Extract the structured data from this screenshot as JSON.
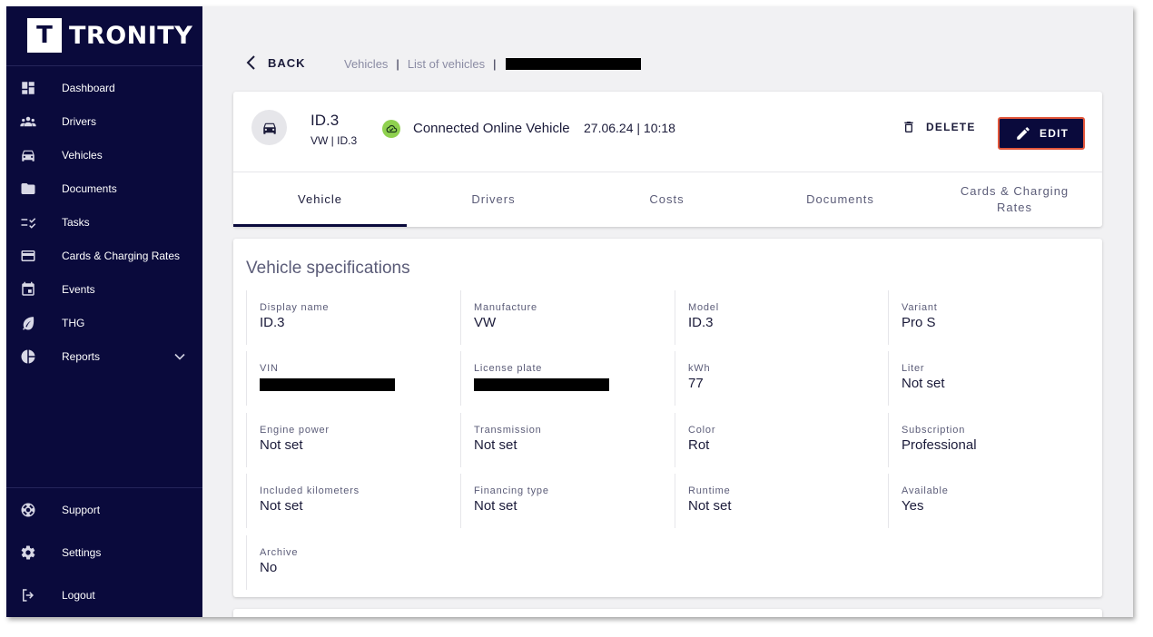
{
  "brand": {
    "logo_letter": "T",
    "name": "TRONITY"
  },
  "sidebar": {
    "items": [
      {
        "label": "Dashboard",
        "icon": "dashboard-icon"
      },
      {
        "label": "Drivers",
        "icon": "people-icon"
      },
      {
        "label": "Vehicles",
        "icon": "car-icon"
      },
      {
        "label": "Documents",
        "icon": "folder-icon"
      },
      {
        "label": "Tasks",
        "icon": "tasks-icon"
      },
      {
        "label": "Cards & Charging Rates",
        "icon": "card-icon"
      },
      {
        "label": "Events",
        "icon": "calendar-icon"
      },
      {
        "label": "THG",
        "icon": "leaf-icon"
      },
      {
        "label": "Reports",
        "icon": "pie-chart-icon"
      }
    ],
    "bottom_items": [
      {
        "label": "Support",
        "icon": "lifebuoy-icon"
      },
      {
        "label": "Settings",
        "icon": "gear-icon"
      },
      {
        "label": "Logout",
        "icon": "logout-icon"
      }
    ]
  },
  "toolbar": {
    "back_label": "BACK"
  },
  "breadcrumb": {
    "items": [
      "Vehicles",
      "List of vehicles"
    ]
  },
  "vehicle": {
    "name": "ID.3",
    "subtitle": "VW | ID.3",
    "connection_status": "Connected Online Vehicle",
    "last_update": "27.06.24 | 10:18"
  },
  "actions": {
    "delete_label": "DELETE",
    "edit_label": "EDIT"
  },
  "tabs": [
    {
      "label": "Vehicle"
    },
    {
      "label": "Drivers"
    },
    {
      "label": "Costs"
    },
    {
      "label": "Documents"
    },
    {
      "label": "Cards & Charging Rates"
    }
  ],
  "specs": {
    "title": "Vehicle specifications",
    "fields": [
      {
        "label": "Display name",
        "value": "ID.3"
      },
      {
        "label": "Manufacture",
        "value": "VW"
      },
      {
        "label": "Model",
        "value": "ID.3"
      },
      {
        "label": "Variant",
        "value": "Pro S"
      },
      {
        "label": "VIN",
        "value": ""
      },
      {
        "label": "License plate",
        "value": ""
      },
      {
        "label": "kWh",
        "value": "77"
      },
      {
        "label": "Liter",
        "value": "Not set"
      },
      {
        "label": "Engine power",
        "value": "Not set"
      },
      {
        "label": "Transmission",
        "value": "Not set"
      },
      {
        "label": "Color",
        "value": "Rot"
      },
      {
        "label": "Subscription",
        "value": "Professional"
      },
      {
        "label": "Included kilometers",
        "value": "Not set"
      },
      {
        "label": "Financing type",
        "value": "Not set"
      },
      {
        "label": "Runtime",
        "value": "Not set"
      },
      {
        "label": "Available",
        "value": "Yes"
      },
      {
        "label": "Archive",
        "value": "No"
      }
    ]
  },
  "colors": {
    "sidebar_bg": "#0a0a3c",
    "page_bg": "#f1f1f3",
    "primary": "#0a0a3c",
    "edit_outline": "#e2553a",
    "online_badge": "#8fd14f"
  }
}
